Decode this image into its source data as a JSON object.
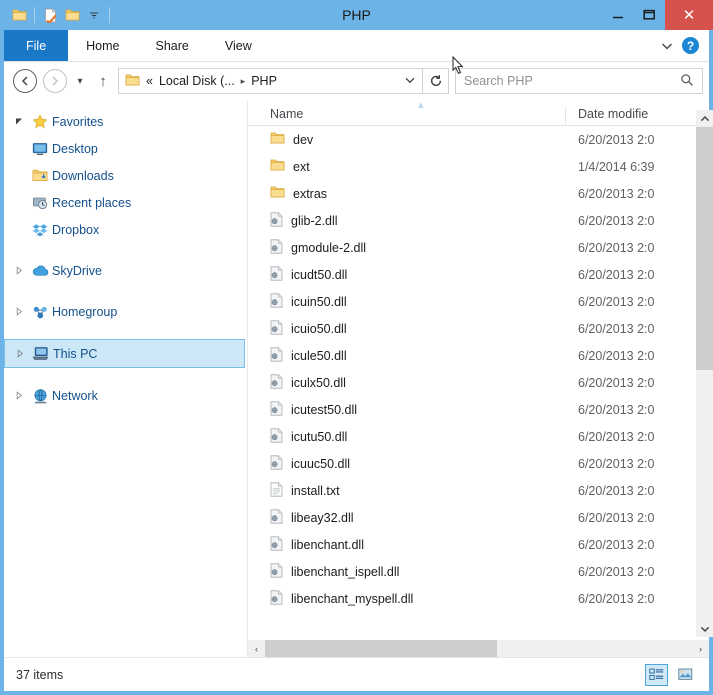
{
  "window": {
    "title": "PHP",
    "minimize_label": "–",
    "maximize_label": "❑",
    "close_label": "✕"
  },
  "quick_access": {
    "items": [
      {
        "name": "folder-icon",
        "label": ""
      },
      {
        "name": "properties-icon",
        "label": ""
      },
      {
        "name": "new-folder-icon",
        "label": ""
      },
      {
        "name": "customize-dropdown-icon",
        "label": "▾"
      }
    ]
  },
  "ribbon": {
    "tabs": [
      {
        "label": "File",
        "active": true
      },
      {
        "label": "Home",
        "active": false
      },
      {
        "label": "Share",
        "active": false
      },
      {
        "label": "View",
        "active": false
      }
    ],
    "expand_label": "⌄",
    "help_label": "?"
  },
  "address_bar": {
    "back_label": "←",
    "forward_label": "→",
    "recent_label": "▾",
    "up_label": "↑",
    "breadcrumb": {
      "overflow": "«",
      "segments": [
        "Local Disk (...",
        "PHP"
      ],
      "separator": "▸",
      "dropdown": "⌄"
    },
    "refresh_label": "↻"
  },
  "search": {
    "placeholder": "Search PHP",
    "value": "",
    "icon": "search-icon"
  },
  "sidebar": {
    "groups": [
      {
        "label": "Favorites",
        "icon": "star-icon",
        "expander": "◢",
        "expanded": true,
        "children": [
          {
            "label": "Desktop",
            "icon": "desktop-icon"
          },
          {
            "label": "Downloads",
            "icon": "downloads-folder-icon"
          },
          {
            "label": "Recent places",
            "icon": "recent-places-icon"
          },
          {
            "label": "Dropbox",
            "icon": "dropbox-icon"
          }
        ]
      },
      {
        "label": "SkyDrive",
        "icon": "cloud-icon",
        "expander": "▹",
        "expanded": false,
        "children": []
      },
      {
        "label": "Homegroup",
        "icon": "homegroup-icon",
        "expander": "▹",
        "expanded": false,
        "children": []
      },
      {
        "label": "This PC",
        "icon": "computer-icon",
        "expander": "▹",
        "expanded": false,
        "selected": true,
        "children": []
      },
      {
        "label": "Network",
        "icon": "network-icon",
        "expander": "▹",
        "expanded": false,
        "children": []
      }
    ]
  },
  "file_list": {
    "columns": [
      {
        "label": "Name",
        "sorted": "asc",
        "sort_glyph": "▴"
      },
      {
        "label": "Date modifie"
      }
    ],
    "rows": [
      {
        "name": "dev",
        "icon": "folder-icon",
        "date": "6/20/2013 2:0"
      },
      {
        "name": "ext",
        "icon": "folder-icon",
        "date": "1/4/2014 6:39"
      },
      {
        "name": "extras",
        "icon": "folder-icon",
        "date": "6/20/2013 2:0"
      },
      {
        "name": "glib-2.dll",
        "icon": "dll-icon",
        "date": "6/20/2013 2:0"
      },
      {
        "name": "gmodule-2.dll",
        "icon": "dll-icon",
        "date": "6/20/2013 2:0"
      },
      {
        "name": "icudt50.dll",
        "icon": "dll-icon",
        "date": "6/20/2013 2:0"
      },
      {
        "name": "icuin50.dll",
        "icon": "dll-icon",
        "date": "6/20/2013 2:0"
      },
      {
        "name": "icuio50.dll",
        "icon": "dll-icon",
        "date": "6/20/2013 2:0"
      },
      {
        "name": "icule50.dll",
        "icon": "dll-icon",
        "date": "6/20/2013 2:0"
      },
      {
        "name": "iculx50.dll",
        "icon": "dll-icon",
        "date": "6/20/2013 2:0"
      },
      {
        "name": "icutest50.dll",
        "icon": "dll-icon",
        "date": "6/20/2013 2:0"
      },
      {
        "name": "icutu50.dll",
        "icon": "dll-icon",
        "date": "6/20/2013 2:0"
      },
      {
        "name": "icuuc50.dll",
        "icon": "dll-icon",
        "date": "6/20/2013 2:0"
      },
      {
        "name": "install.txt",
        "icon": "text-file-icon",
        "date": "6/20/2013 2:0"
      },
      {
        "name": "libeay32.dll",
        "icon": "dll-icon",
        "date": "6/20/2013 2:0"
      },
      {
        "name": "libenchant.dll",
        "icon": "dll-icon",
        "date": "6/20/2013 2:0"
      },
      {
        "name": "libenchant_ispell.dll",
        "icon": "dll-icon",
        "date": "6/20/2013 2:0"
      },
      {
        "name": "libenchant_myspell.dll",
        "icon": "dll-icon",
        "date": "6/20/2013 2:0"
      }
    ]
  },
  "scrollbars": {
    "vertical": {
      "up": "⌃",
      "down": "⌄"
    },
    "horizontal": {
      "left": "‹",
      "right": "›"
    }
  },
  "status_bar": {
    "item_count": "37 items",
    "views": [
      {
        "name": "details-view-button",
        "active": true
      },
      {
        "name": "large-icons-view-button",
        "active": false
      }
    ]
  },
  "colors": {
    "window_frame": "#6cb3e8",
    "file_tab": "#1a78c8",
    "close_button": "#d6524c",
    "selection": "#cce8f7",
    "selection_border": "#7cc0e8",
    "link_text": "#14518c"
  }
}
